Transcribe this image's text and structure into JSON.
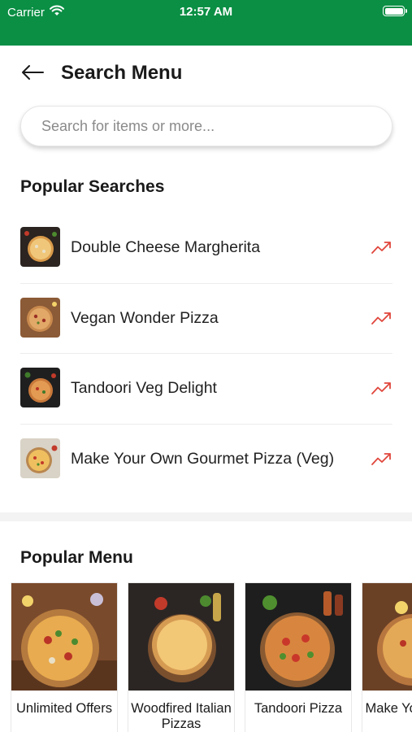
{
  "status_bar": {
    "carrier": "Carrier",
    "time": "12:57 AM"
  },
  "header": {
    "title": "Search Menu"
  },
  "search": {
    "placeholder": "Search for items or more..."
  },
  "popular_searches": {
    "title": "Popular Searches",
    "items": [
      {
        "label": "Double Cheese Margherita"
      },
      {
        "label": "Vegan Wonder Pizza"
      },
      {
        "label": "Tandoori Veg Delight"
      },
      {
        "label": "Make Your Own Gourmet Pizza (Veg)"
      }
    ]
  },
  "popular_menu": {
    "title": "Popular Menu",
    "cards": [
      {
        "label": "Unlimited Offers"
      },
      {
        "label": "Woodfired Italian Pizzas"
      },
      {
        "label": "Tandoori Pizza"
      },
      {
        "label": "Make Your Pizza"
      }
    ]
  },
  "colors": {
    "brand_green": "#0a8f44",
    "trend_red": "#e0463c"
  },
  "icons": {
    "back": "arrow-left-icon",
    "trend": "trending-up-icon",
    "wifi": "wifi-icon",
    "battery": "battery-icon"
  }
}
